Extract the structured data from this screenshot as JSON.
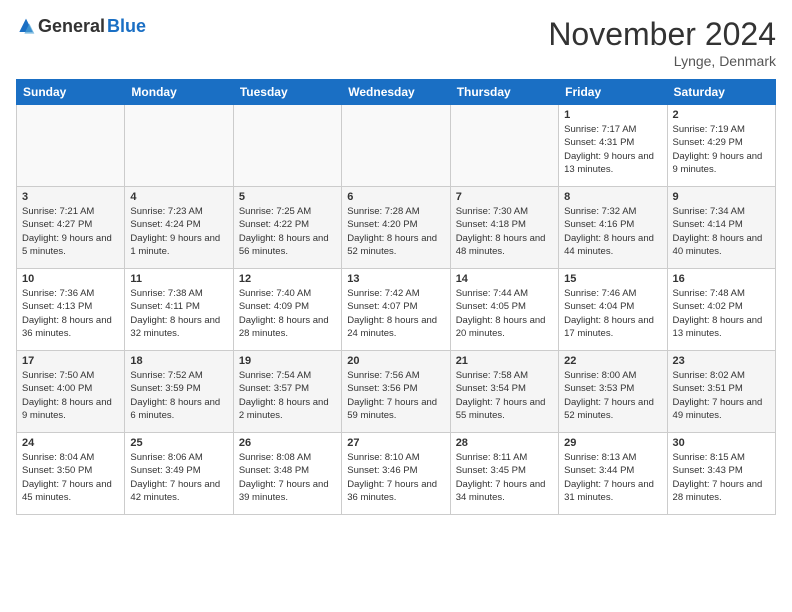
{
  "header": {
    "logo_general": "General",
    "logo_blue": "Blue",
    "month_title": "November 2024",
    "location": "Lynge, Denmark"
  },
  "days_of_week": [
    "Sunday",
    "Monday",
    "Tuesday",
    "Wednesday",
    "Thursday",
    "Friday",
    "Saturday"
  ],
  "weeks": [
    [
      {
        "day": "",
        "info": ""
      },
      {
        "day": "",
        "info": ""
      },
      {
        "day": "",
        "info": ""
      },
      {
        "day": "",
        "info": ""
      },
      {
        "day": "",
        "info": ""
      },
      {
        "day": "1",
        "info": "Sunrise: 7:17 AM\nSunset: 4:31 PM\nDaylight: 9 hours and 13 minutes."
      },
      {
        "day": "2",
        "info": "Sunrise: 7:19 AM\nSunset: 4:29 PM\nDaylight: 9 hours and 9 minutes."
      }
    ],
    [
      {
        "day": "3",
        "info": "Sunrise: 7:21 AM\nSunset: 4:27 PM\nDaylight: 9 hours and 5 minutes."
      },
      {
        "day": "4",
        "info": "Sunrise: 7:23 AM\nSunset: 4:24 PM\nDaylight: 9 hours and 1 minute."
      },
      {
        "day": "5",
        "info": "Sunrise: 7:25 AM\nSunset: 4:22 PM\nDaylight: 8 hours and 56 minutes."
      },
      {
        "day": "6",
        "info": "Sunrise: 7:28 AM\nSunset: 4:20 PM\nDaylight: 8 hours and 52 minutes."
      },
      {
        "day": "7",
        "info": "Sunrise: 7:30 AM\nSunset: 4:18 PM\nDaylight: 8 hours and 48 minutes."
      },
      {
        "day": "8",
        "info": "Sunrise: 7:32 AM\nSunset: 4:16 PM\nDaylight: 8 hours and 44 minutes."
      },
      {
        "day": "9",
        "info": "Sunrise: 7:34 AM\nSunset: 4:14 PM\nDaylight: 8 hours and 40 minutes."
      }
    ],
    [
      {
        "day": "10",
        "info": "Sunrise: 7:36 AM\nSunset: 4:13 PM\nDaylight: 8 hours and 36 minutes."
      },
      {
        "day": "11",
        "info": "Sunrise: 7:38 AM\nSunset: 4:11 PM\nDaylight: 8 hours and 32 minutes."
      },
      {
        "day": "12",
        "info": "Sunrise: 7:40 AM\nSunset: 4:09 PM\nDaylight: 8 hours and 28 minutes."
      },
      {
        "day": "13",
        "info": "Sunrise: 7:42 AM\nSunset: 4:07 PM\nDaylight: 8 hours and 24 minutes."
      },
      {
        "day": "14",
        "info": "Sunrise: 7:44 AM\nSunset: 4:05 PM\nDaylight: 8 hours and 20 minutes."
      },
      {
        "day": "15",
        "info": "Sunrise: 7:46 AM\nSunset: 4:04 PM\nDaylight: 8 hours and 17 minutes."
      },
      {
        "day": "16",
        "info": "Sunrise: 7:48 AM\nSunset: 4:02 PM\nDaylight: 8 hours and 13 minutes."
      }
    ],
    [
      {
        "day": "17",
        "info": "Sunrise: 7:50 AM\nSunset: 4:00 PM\nDaylight: 8 hours and 9 minutes."
      },
      {
        "day": "18",
        "info": "Sunrise: 7:52 AM\nSunset: 3:59 PM\nDaylight: 8 hours and 6 minutes."
      },
      {
        "day": "19",
        "info": "Sunrise: 7:54 AM\nSunset: 3:57 PM\nDaylight: 8 hours and 2 minutes."
      },
      {
        "day": "20",
        "info": "Sunrise: 7:56 AM\nSunset: 3:56 PM\nDaylight: 7 hours and 59 minutes."
      },
      {
        "day": "21",
        "info": "Sunrise: 7:58 AM\nSunset: 3:54 PM\nDaylight: 7 hours and 55 minutes."
      },
      {
        "day": "22",
        "info": "Sunrise: 8:00 AM\nSunset: 3:53 PM\nDaylight: 7 hours and 52 minutes."
      },
      {
        "day": "23",
        "info": "Sunrise: 8:02 AM\nSunset: 3:51 PM\nDaylight: 7 hours and 49 minutes."
      }
    ],
    [
      {
        "day": "24",
        "info": "Sunrise: 8:04 AM\nSunset: 3:50 PM\nDaylight: 7 hours and 45 minutes."
      },
      {
        "day": "25",
        "info": "Sunrise: 8:06 AM\nSunset: 3:49 PM\nDaylight: 7 hours and 42 minutes."
      },
      {
        "day": "26",
        "info": "Sunrise: 8:08 AM\nSunset: 3:48 PM\nDaylight: 7 hours and 39 minutes."
      },
      {
        "day": "27",
        "info": "Sunrise: 8:10 AM\nSunset: 3:46 PM\nDaylight: 7 hours and 36 minutes."
      },
      {
        "day": "28",
        "info": "Sunrise: 8:11 AM\nSunset: 3:45 PM\nDaylight: 7 hours and 34 minutes."
      },
      {
        "day": "29",
        "info": "Sunrise: 8:13 AM\nSunset: 3:44 PM\nDaylight: 7 hours and 31 minutes."
      },
      {
        "day": "30",
        "info": "Sunrise: 8:15 AM\nSunset: 3:43 PM\nDaylight: 7 hours and 28 minutes."
      }
    ]
  ]
}
